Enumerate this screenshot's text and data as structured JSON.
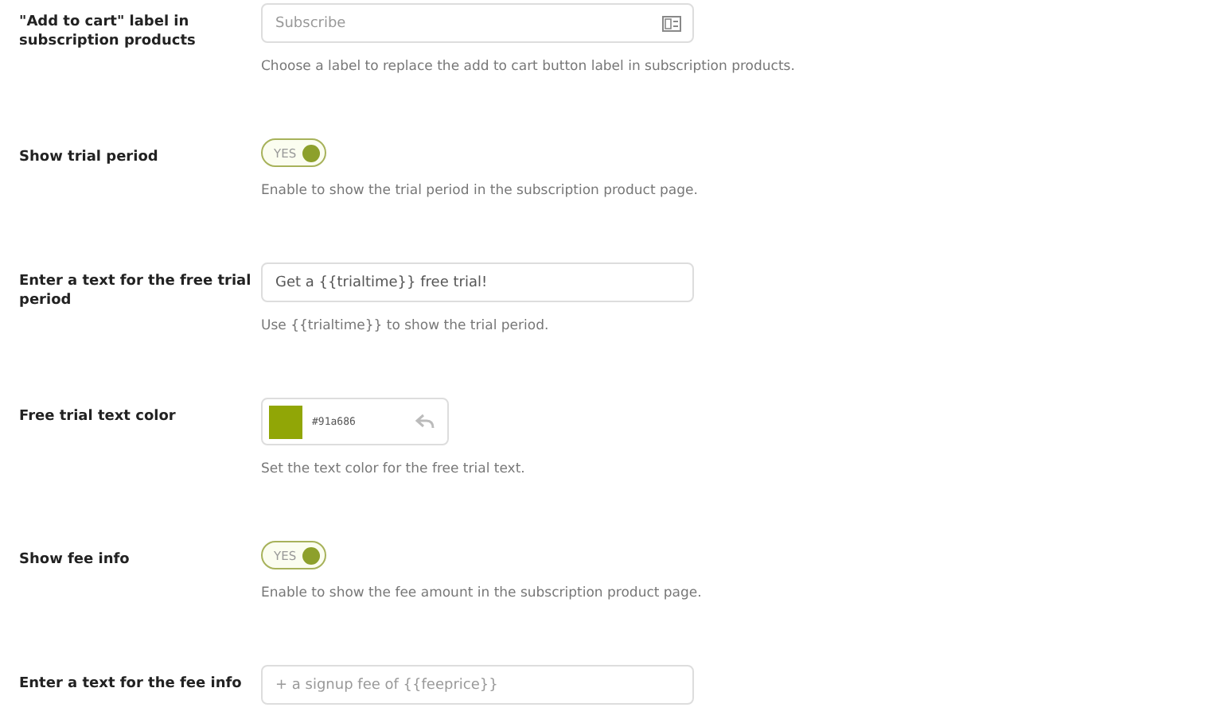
{
  "settings": [
    {
      "kind": "text",
      "label": "\"Add to cart\" label in subscription products",
      "placeholder": "Subscribe",
      "has_icon": true,
      "description": "Choose a label to replace the add to cart button label in subscription products."
    },
    {
      "kind": "toggle",
      "label": "Show trial period",
      "toggle_text": "YES",
      "on": true,
      "description": "Enable to show the trial period in the subscription product page."
    },
    {
      "kind": "text",
      "label": "Enter a text for the free trial period",
      "value": "Get a {{trialtime}} free trial!",
      "description": "Use {{trialtime}} to show the trial period."
    },
    {
      "kind": "color",
      "label": "Free trial text color",
      "value": "#91a686",
      "color": "#91a606",
      "description": "Set the text color for the free trial text."
    },
    {
      "kind": "toggle",
      "label": "Show fee info",
      "toggle_text": "YES",
      "on": true,
      "description": "Enable to show the fee amount in the subscription product page."
    },
    {
      "kind": "text",
      "label": "Enter a text for the fee info",
      "placeholder": "+ a signup fee of {{feeprice}}"
    }
  ]
}
